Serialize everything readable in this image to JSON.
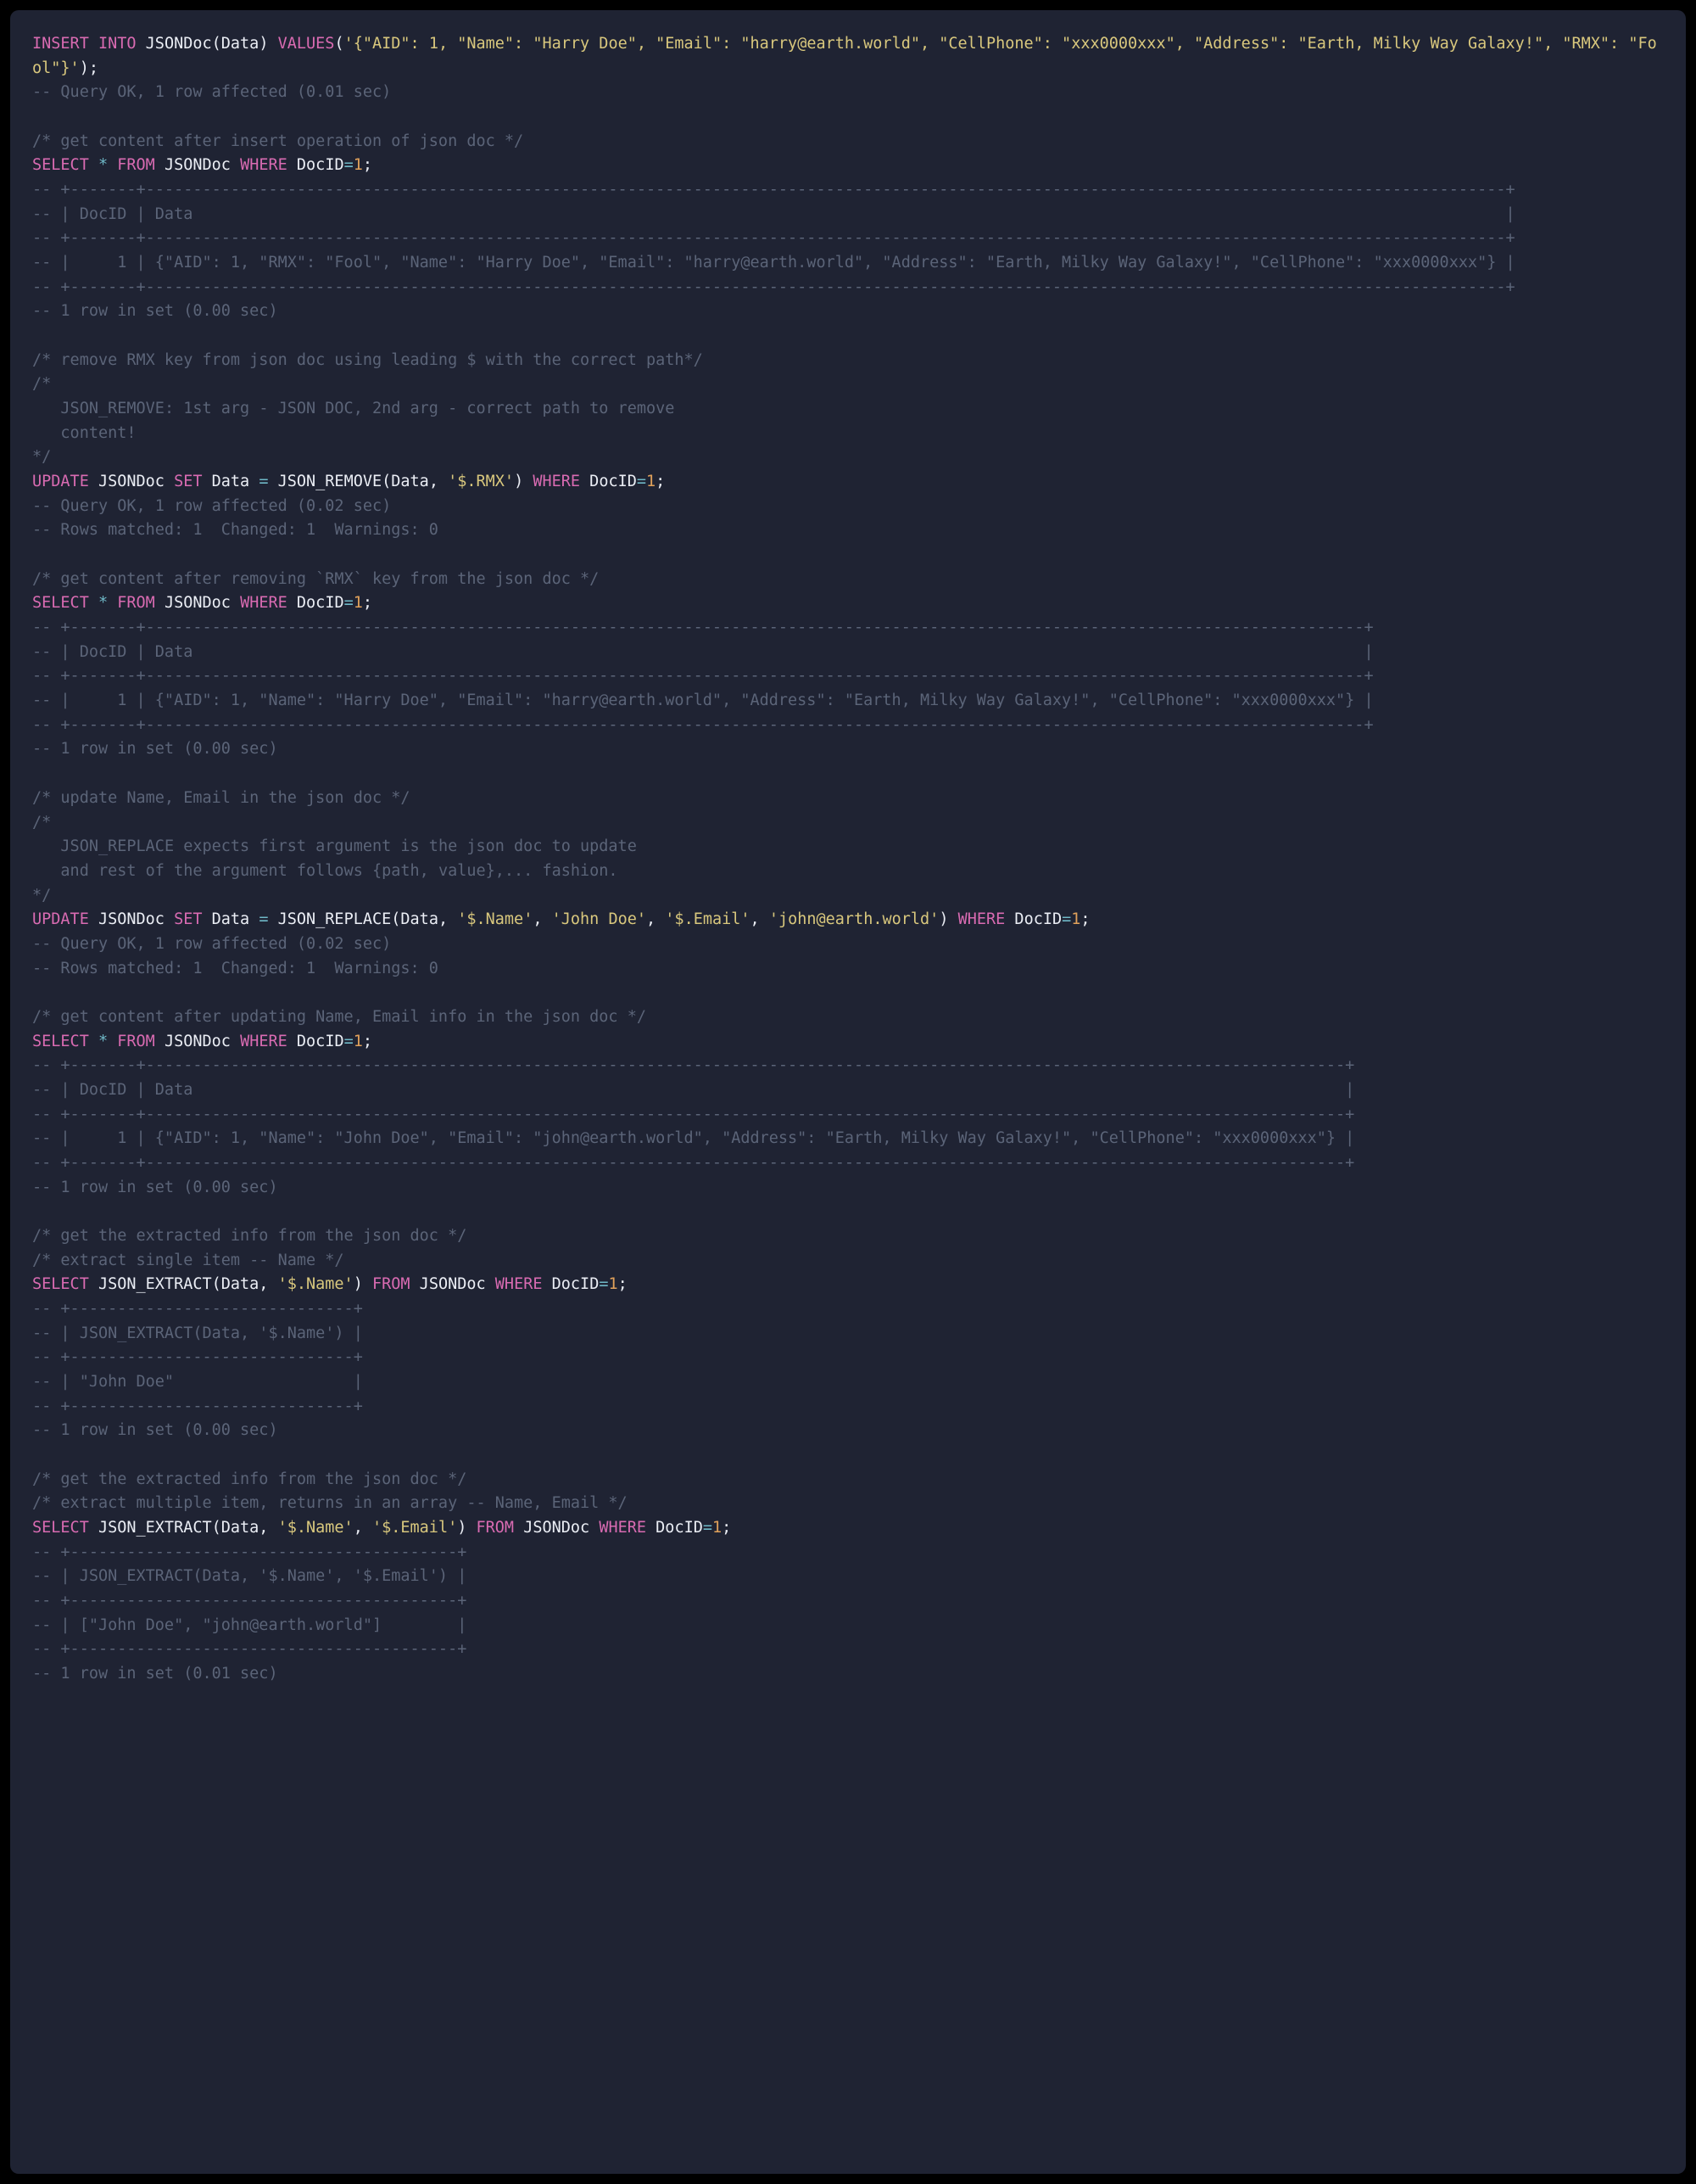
{
  "lines": [
    [
      {
        "c": "kw",
        "t": "INSERT INTO"
      },
      {
        "c": "ident",
        "t": " JSONDoc(Data) "
      },
      {
        "c": "kw",
        "t": "VALUES"
      },
      {
        "c": "ident",
        "t": "("
      },
      {
        "c": "str",
        "t": "'{\"AID\": 1, \"Name\": \"Harry Doe\", \"Email\": \"harry@earth.world\", \"CellPhone\": \"xxx0000xxx\", \"Address\": \"Earth, Milky Way Galaxy!\", \"RMX\": \"Fool\"}'"
      },
      {
        "c": "ident",
        "t": ");"
      }
    ],
    [
      {
        "c": "cmt",
        "t": "-- Query OK, 1 row affected (0.01 sec)"
      }
    ],
    [
      {
        "c": "ident",
        "t": ""
      }
    ],
    [
      {
        "c": "cmt",
        "t": "/* get content after insert operation of json doc */"
      }
    ],
    [
      {
        "c": "kw",
        "t": "SELECT"
      },
      {
        "c": "ident",
        "t": " "
      },
      {
        "c": "op",
        "t": "*"
      },
      {
        "c": "ident",
        "t": " "
      },
      {
        "c": "kw",
        "t": "FROM"
      },
      {
        "c": "ident",
        "t": " JSONDoc "
      },
      {
        "c": "kw",
        "t": "WHERE"
      },
      {
        "c": "ident",
        "t": " DocID"
      },
      {
        "c": "op",
        "t": "="
      },
      {
        "c": "num",
        "t": "1"
      },
      {
        "c": "ident",
        "t": ";"
      }
    ],
    [
      {
        "c": "cmt",
        "t": "-- +-------+------------------------------------------------------------------------------------------------------------------------------------------------+"
      }
    ],
    [
      {
        "c": "cmt",
        "t": "-- | DocID | Data                                                                                                                                           |"
      }
    ],
    [
      {
        "c": "cmt",
        "t": "-- +-------+------------------------------------------------------------------------------------------------------------------------------------------------+"
      }
    ],
    [
      {
        "c": "cmt",
        "t": "-- |     1 | {\"AID\": 1, \"RMX\": \"Fool\", \"Name\": \"Harry Doe\", \"Email\": \"harry@earth.world\", \"Address\": \"Earth, Milky Way Galaxy!\", \"CellPhone\": \"xxx0000xxx\"} |"
      }
    ],
    [
      {
        "c": "cmt",
        "t": "-- +-------+------------------------------------------------------------------------------------------------------------------------------------------------+"
      }
    ],
    [
      {
        "c": "cmt",
        "t": "-- 1 row in set (0.00 sec)"
      }
    ],
    [
      {
        "c": "ident",
        "t": ""
      }
    ],
    [
      {
        "c": "cmt",
        "t": "/* remove RMX key from json doc using leading $ with the correct path*/"
      }
    ],
    [
      {
        "c": "cmt",
        "t": "/*"
      }
    ],
    [
      {
        "c": "cmt",
        "t": "   JSON_REMOVE: 1st arg - JSON DOC, 2nd arg - correct path to remove"
      }
    ],
    [
      {
        "c": "cmt",
        "t": "   content!"
      }
    ],
    [
      {
        "c": "cmt",
        "t": "*/"
      }
    ],
    [
      {
        "c": "kw",
        "t": "UPDATE"
      },
      {
        "c": "ident",
        "t": " JSONDoc "
      },
      {
        "c": "kw",
        "t": "SET"
      },
      {
        "c": "ident",
        "t": " Data "
      },
      {
        "c": "op",
        "t": "="
      },
      {
        "c": "ident",
        "t": " JSON_REMOVE(Data, "
      },
      {
        "c": "str",
        "t": "'$.RMX'"
      },
      {
        "c": "ident",
        "t": ") "
      },
      {
        "c": "kw",
        "t": "WHERE"
      },
      {
        "c": "ident",
        "t": " DocID"
      },
      {
        "c": "op",
        "t": "="
      },
      {
        "c": "num",
        "t": "1"
      },
      {
        "c": "ident",
        "t": ";"
      }
    ],
    [
      {
        "c": "cmt",
        "t": "-- Query OK, 1 row affected (0.02 sec)"
      }
    ],
    [
      {
        "c": "cmt",
        "t": "-- Rows matched: 1  Changed: 1  Warnings: 0"
      }
    ],
    [
      {
        "c": "ident",
        "t": ""
      }
    ],
    [
      {
        "c": "cmt",
        "t": "/* get content after removing `RMX` key from the json doc */"
      }
    ],
    [
      {
        "c": "kw",
        "t": "SELECT"
      },
      {
        "c": "ident",
        "t": " "
      },
      {
        "c": "op",
        "t": "*"
      },
      {
        "c": "ident",
        "t": " "
      },
      {
        "c": "kw",
        "t": "FROM"
      },
      {
        "c": "ident",
        "t": " JSONDoc "
      },
      {
        "c": "kw",
        "t": "WHERE"
      },
      {
        "c": "ident",
        "t": " DocID"
      },
      {
        "c": "op",
        "t": "="
      },
      {
        "c": "num",
        "t": "1"
      },
      {
        "c": "ident",
        "t": ";"
      }
    ],
    [
      {
        "c": "cmt",
        "t": "-- +-------+---------------------------------------------------------------------------------------------------------------------------------+"
      }
    ],
    [
      {
        "c": "cmt",
        "t": "-- | DocID | Data                                                                                                                            |"
      }
    ],
    [
      {
        "c": "cmt",
        "t": "-- +-------+---------------------------------------------------------------------------------------------------------------------------------+"
      }
    ],
    [
      {
        "c": "cmt",
        "t": "-- |     1 | {\"AID\": 1, \"Name\": \"Harry Doe\", \"Email\": \"harry@earth.world\", \"Address\": \"Earth, Milky Way Galaxy!\", \"CellPhone\": \"xxx0000xxx\"} |"
      }
    ],
    [
      {
        "c": "cmt",
        "t": "-- +-------+---------------------------------------------------------------------------------------------------------------------------------+"
      }
    ],
    [
      {
        "c": "cmt",
        "t": "-- 1 row in set (0.00 sec)"
      }
    ],
    [
      {
        "c": "ident",
        "t": ""
      }
    ],
    [
      {
        "c": "cmt",
        "t": "/* update Name, Email in the json doc */"
      }
    ],
    [
      {
        "c": "cmt",
        "t": "/*"
      }
    ],
    [
      {
        "c": "cmt",
        "t": "   JSON_REPLACE expects first argument is the json doc to update"
      }
    ],
    [
      {
        "c": "cmt",
        "t": "   and rest of the argument follows {path, value},... fashion."
      }
    ],
    [
      {
        "c": "cmt",
        "t": "*/"
      }
    ],
    [
      {
        "c": "kw",
        "t": "UPDATE"
      },
      {
        "c": "ident",
        "t": " JSONDoc "
      },
      {
        "c": "kw",
        "t": "SET"
      },
      {
        "c": "ident",
        "t": " Data "
      },
      {
        "c": "op",
        "t": "="
      },
      {
        "c": "ident",
        "t": " JSON_REPLACE(Data, "
      },
      {
        "c": "str",
        "t": "'$.Name'"
      },
      {
        "c": "ident",
        "t": ", "
      },
      {
        "c": "str",
        "t": "'John Doe'"
      },
      {
        "c": "ident",
        "t": ", "
      },
      {
        "c": "str",
        "t": "'$.Email'"
      },
      {
        "c": "ident",
        "t": ", "
      },
      {
        "c": "str",
        "t": "'john@earth.world'"
      },
      {
        "c": "ident",
        "t": ") "
      },
      {
        "c": "kw",
        "t": "WHERE"
      },
      {
        "c": "ident",
        "t": " DocID"
      },
      {
        "c": "op",
        "t": "="
      },
      {
        "c": "num",
        "t": "1"
      },
      {
        "c": "ident",
        "t": ";"
      }
    ],
    [
      {
        "c": "cmt",
        "t": "-- Query OK, 1 row affected (0.02 sec)"
      }
    ],
    [
      {
        "c": "cmt",
        "t": "-- Rows matched: 1  Changed: 1  Warnings: 0"
      }
    ],
    [
      {
        "c": "ident",
        "t": ""
      }
    ],
    [
      {
        "c": "cmt",
        "t": "/* get content after updating Name, Email info in the json doc */"
      }
    ],
    [
      {
        "c": "kw",
        "t": "SELECT"
      },
      {
        "c": "ident",
        "t": " "
      },
      {
        "c": "op",
        "t": "*"
      },
      {
        "c": "ident",
        "t": " "
      },
      {
        "c": "kw",
        "t": "FROM"
      },
      {
        "c": "ident",
        "t": " JSONDoc "
      },
      {
        "c": "kw",
        "t": "WHERE"
      },
      {
        "c": "ident",
        "t": " DocID"
      },
      {
        "c": "op",
        "t": "="
      },
      {
        "c": "num",
        "t": "1"
      },
      {
        "c": "ident",
        "t": ";"
      }
    ],
    [
      {
        "c": "cmt",
        "t": "-- +-------+-------------------------------------------------------------------------------------------------------------------------------+"
      }
    ],
    [
      {
        "c": "cmt",
        "t": "-- | DocID | Data                                                                                                                          |"
      }
    ],
    [
      {
        "c": "cmt",
        "t": "-- +-------+-------------------------------------------------------------------------------------------------------------------------------+"
      }
    ],
    [
      {
        "c": "cmt",
        "t": "-- |     1 | {\"AID\": 1, \"Name\": \"John Doe\", \"Email\": \"john@earth.world\", \"Address\": \"Earth, Milky Way Galaxy!\", \"CellPhone\": \"xxx0000xxx\"} |"
      }
    ],
    [
      {
        "c": "cmt",
        "t": "-- +-------+-------------------------------------------------------------------------------------------------------------------------------+"
      }
    ],
    [
      {
        "c": "cmt",
        "t": "-- 1 row in set (0.00 sec)"
      }
    ],
    [
      {
        "c": "ident",
        "t": ""
      }
    ],
    [
      {
        "c": "cmt",
        "t": "/* get the extracted info from the json doc */"
      }
    ],
    [
      {
        "c": "cmt",
        "t": "/* extract single item -- Name */"
      }
    ],
    [
      {
        "c": "kw",
        "t": "SELECT"
      },
      {
        "c": "ident",
        "t": " JSON_EXTRACT(Data, "
      },
      {
        "c": "str",
        "t": "'$.Name'"
      },
      {
        "c": "ident",
        "t": ") "
      },
      {
        "c": "kw",
        "t": "FROM"
      },
      {
        "c": "ident",
        "t": " JSONDoc "
      },
      {
        "c": "kw",
        "t": "WHERE"
      },
      {
        "c": "ident",
        "t": " DocID"
      },
      {
        "c": "op",
        "t": "="
      },
      {
        "c": "num",
        "t": "1"
      },
      {
        "c": "ident",
        "t": ";"
      }
    ],
    [
      {
        "c": "cmt",
        "t": "-- +------------------------------+"
      }
    ],
    [
      {
        "c": "cmt",
        "t": "-- | JSON_EXTRACT(Data, '$.Name') |"
      }
    ],
    [
      {
        "c": "cmt",
        "t": "-- +------------------------------+"
      }
    ],
    [
      {
        "c": "cmt",
        "t": "-- | \"John Doe\"                   |"
      }
    ],
    [
      {
        "c": "cmt",
        "t": "-- +------------------------------+"
      }
    ],
    [
      {
        "c": "cmt",
        "t": "-- 1 row in set (0.00 sec)"
      }
    ],
    [
      {
        "c": "ident",
        "t": ""
      }
    ],
    [
      {
        "c": "cmt",
        "t": "/* get the extracted info from the json doc */"
      }
    ],
    [
      {
        "c": "cmt",
        "t": "/* extract multiple item, returns in an array -- Name, Email */"
      }
    ],
    [
      {
        "c": "kw",
        "t": "SELECT"
      },
      {
        "c": "ident",
        "t": " JSON_EXTRACT(Data, "
      },
      {
        "c": "str",
        "t": "'$.Name'"
      },
      {
        "c": "ident",
        "t": ", "
      },
      {
        "c": "str",
        "t": "'$.Email'"
      },
      {
        "c": "ident",
        "t": ") "
      },
      {
        "c": "kw",
        "t": "FROM"
      },
      {
        "c": "ident",
        "t": " JSONDoc "
      },
      {
        "c": "kw",
        "t": "WHERE"
      },
      {
        "c": "ident",
        "t": " DocID"
      },
      {
        "c": "op",
        "t": "="
      },
      {
        "c": "num",
        "t": "1"
      },
      {
        "c": "ident",
        "t": ";"
      }
    ],
    [
      {
        "c": "cmt",
        "t": "-- +-----------------------------------------+"
      }
    ],
    [
      {
        "c": "cmt",
        "t": "-- | JSON_EXTRACT(Data, '$.Name', '$.Email') |"
      }
    ],
    [
      {
        "c": "cmt",
        "t": "-- +-----------------------------------------+"
      }
    ],
    [
      {
        "c": "cmt",
        "t": "-- | [\"John Doe\", \"john@earth.world\"]        |"
      }
    ],
    [
      {
        "c": "cmt",
        "t": "-- +-----------------------------------------+"
      }
    ],
    [
      {
        "c": "cmt",
        "t": "-- 1 row in set (0.01 sec)"
      }
    ]
  ]
}
